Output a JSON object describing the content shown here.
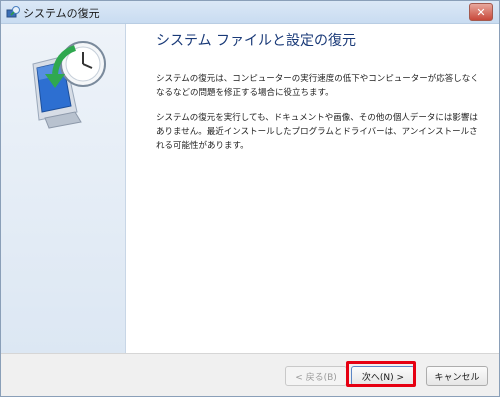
{
  "window": {
    "title": "システムの復元",
    "close_label": "✕"
  },
  "content": {
    "heading": "システム ファイルと設定の復元",
    "paragraph1": "システムの復元は、コンピューターの実行速度の低下やコンピューターが応答しなくなるなどの問題を修正する場合に役立ちます。",
    "paragraph2": "システムの復元を実行しても、ドキュメントや画像、その他の個人データには影響はありません。最近インストールしたプログラムとドライバーは、アンインストールされる可能性があります。"
  },
  "buttons": {
    "back": "< 戻る(B)",
    "next": "次へ(N) >",
    "cancel": "キャンセル"
  },
  "icons": {
    "app": "system-restore-icon",
    "illustration": "system-restore-illustration",
    "close": "close-icon"
  },
  "colors": {
    "highlight": "#e60012",
    "heading": "#1a3a78"
  }
}
